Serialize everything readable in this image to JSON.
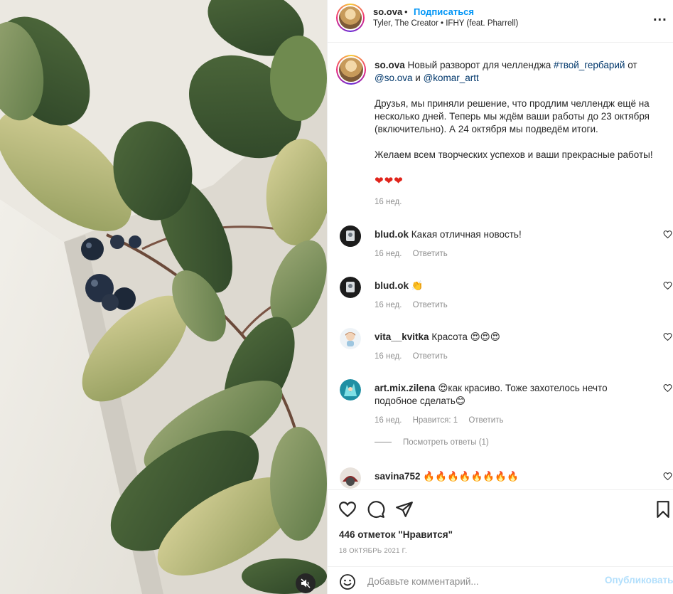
{
  "header": {
    "username": "so.ova",
    "separator": "•",
    "follow_label": "Подписаться",
    "audio": "Tyler, The Creator • IFHY (feat. Pharrell)",
    "more_label": "..."
  },
  "caption": {
    "username": "so.ova",
    "line1_pre": "Новый разворот для челленджа",
    "hashtag": "#твой_гербарий",
    "line1_mid": "от",
    "mention1": "@so.ova",
    "and_word": "и",
    "mention2": "@komar_artt",
    "paragraph2": "Друзья, мы приняли решение, что продлим челлендж ещё на несколько дней. Теперь мы ждём ваши работы до 23 октября (включительно). А 24 октября мы подведём итоги.",
    "paragraph3": "Желаем всем творческих успехов и ваши прекрасные работы!",
    "emoji": "❤❤❤",
    "time": "16 нед."
  },
  "comments": [
    {
      "username": "blud.ok",
      "text": "Какая отличная новость!",
      "time": "16 нед.",
      "reply": "Ответить"
    },
    {
      "username": "blud.ok",
      "text": "👏",
      "time": "16 нед.",
      "reply": "Ответить"
    },
    {
      "username": "vita__kvitka",
      "text": "Красота 😍😍😍",
      "time": "16 нед.",
      "reply": "Ответить"
    },
    {
      "username": "art.mix.zilena",
      "text": "😍как красиво. Тоже захотелось нечто подобное сделать😊",
      "time": "16 нед.",
      "likes": "Нравится: 1",
      "reply": "Ответить"
    },
    {
      "username": "savina752",
      "text": "🔥🔥🔥🔥🔥🔥🔥🔥"
    }
  ],
  "view_replies": "Посмотреть ответы (1)",
  "likes_text": "446 отметок \"Нравится\"",
  "date": "18 ОКТЯБРЬ 2021 Г.",
  "add_comment": {
    "placeholder": "Добавьте комментарий...",
    "publish_label": "Опубликовать"
  },
  "icons": {
    "mute": "speaker-muted-icon",
    "like": "heart-outline-icon",
    "comment": "comment-bubble-icon",
    "share": "paper-plane-icon",
    "save": "bookmark-icon",
    "emoji": "smiley-icon"
  },
  "colors": {
    "link": "#00376b",
    "follow": "#0095f6",
    "muted_text": "#8e8e8e",
    "publish_disabled": "#b2dffc"
  }
}
